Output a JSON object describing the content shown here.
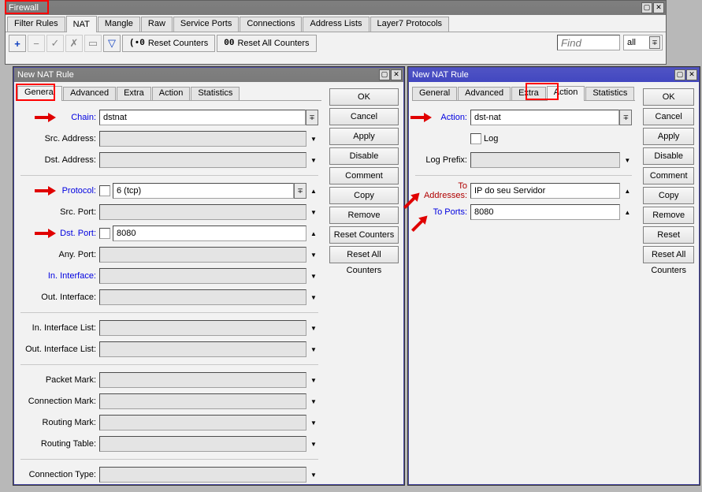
{
  "firewall": {
    "title": "Firewall",
    "tabs": [
      "Filter Rules",
      "NAT",
      "Mangle",
      "Raw",
      "Service Ports",
      "Connections",
      "Address Lists",
      "Layer7 Protocols"
    ],
    "active_tab_index": 1,
    "toolbar": {
      "reset_counters": "Reset Counters",
      "reset_all_counters": "Reset All Counters",
      "find_placeholder": "Find",
      "filter_value": "all"
    }
  },
  "nat_rule_left": {
    "title": "New NAT Rule",
    "tabs": [
      "General",
      "Advanced",
      "Extra",
      "Action",
      "Statistics"
    ],
    "active_tab_index": 0,
    "fields": {
      "chain_label": "Chain:",
      "chain_value": "dstnat",
      "src_address_label": "Src. Address:",
      "dst_address_label": "Dst. Address:",
      "protocol_label": "Protocol:",
      "protocol_value": "6 (tcp)",
      "src_port_label": "Src. Port:",
      "dst_port_label": "Dst. Port:",
      "dst_port_value": "8080",
      "any_port_label": "Any. Port:",
      "in_iface_label": "In. Interface:",
      "out_iface_label": "Out. Interface:",
      "in_iface_list_label": "In. Interface List:",
      "out_iface_list_label": "Out. Interface List:",
      "packet_mark_label": "Packet Mark:",
      "connection_mark_label": "Connection Mark:",
      "routing_mark_label": "Routing Mark:",
      "routing_table_label": "Routing Table:",
      "connection_type_label": "Connection Type:"
    }
  },
  "nat_rule_right": {
    "title": "New NAT Rule",
    "tabs": [
      "General",
      "Advanced",
      "Extra",
      "Action",
      "Statistics"
    ],
    "active_tab_index": 3,
    "fields": {
      "action_label": "Action:",
      "action_value": "dst-nat",
      "log_label": "Log",
      "log_prefix_label": "Log Prefix:",
      "to_addresses_label": "To Addresses:",
      "to_addresses_value": "IP do seu Servidor",
      "to_ports_label": "To Ports:",
      "to_ports_value": "8080"
    }
  },
  "side_buttons": {
    "ok": "OK",
    "cancel": "Cancel",
    "apply": "Apply",
    "disable": "Disable",
    "comment": "Comment",
    "copy": "Copy",
    "remove": "Remove",
    "reset_counters": "Reset Counters",
    "reset_all_counters": "Reset All Counters"
  }
}
